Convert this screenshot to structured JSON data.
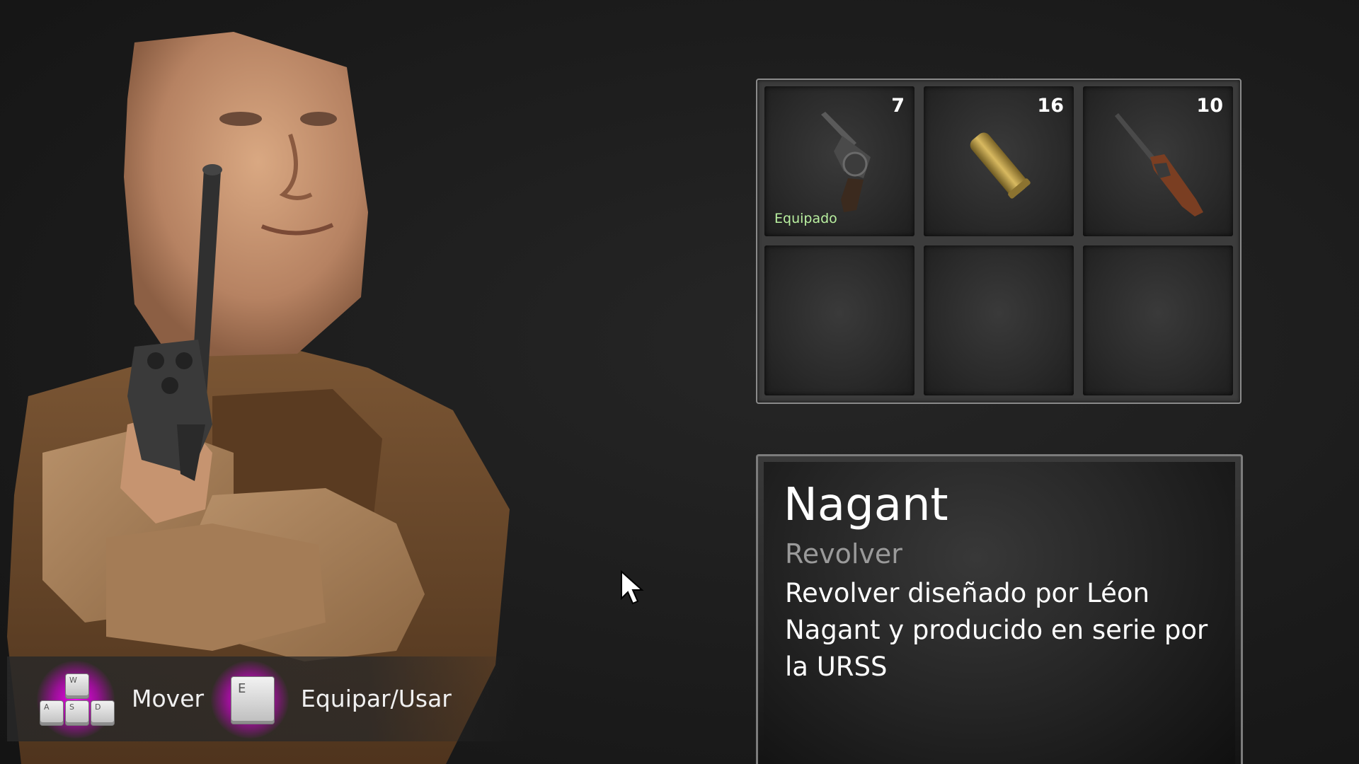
{
  "character": {
    "icon": "character-portrait"
  },
  "controls": [
    {
      "key_icon": "wasd-keys-icon",
      "key_letters": [
        "W",
        "A",
        "S",
        "D"
      ],
      "label": "Mover"
    },
    {
      "key_icon": "e-key-icon",
      "key_letters": [
        "E"
      ],
      "label": "Equipar/Usar"
    }
  ],
  "colors": {
    "glow": "#ff00ff",
    "equipped_text": "#b9f0a0",
    "item_type_text": "#9a9a9a"
  },
  "inventory": {
    "slots": [
      {
        "icon": "revolver-icon",
        "count": "7",
        "status": "Equipado"
      },
      {
        "icon": "bullet-icon",
        "count": "16",
        "status": ""
      },
      {
        "icon": "rifle-icon",
        "count": "10",
        "status": ""
      },
      {
        "icon": "",
        "count": "",
        "status": ""
      },
      {
        "icon": "",
        "count": "",
        "status": ""
      },
      {
        "icon": "",
        "count": "",
        "status": ""
      }
    ]
  },
  "details": {
    "name": "Nagant",
    "type": "Revolver",
    "description": "Revolver diseñado por Léon Nagant y producido en serie por la URSS"
  }
}
